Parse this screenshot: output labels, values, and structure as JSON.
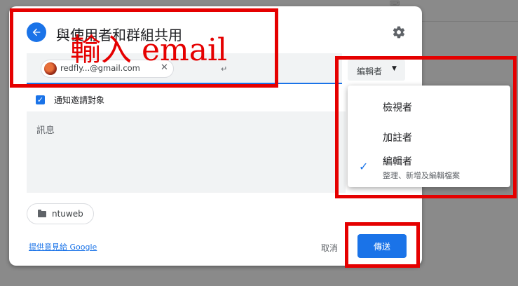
{
  "dialog": {
    "title": "與使用者和群組共用",
    "back_icon": "arrow-left-icon",
    "settings_icon": "gear-icon"
  },
  "recipient": {
    "email": "redfly...@gmail.com",
    "enter_mark": "↵"
  },
  "role_button": {
    "label": "編輯者",
    "caret": "▼"
  },
  "notify": {
    "checked": true,
    "label": "通知邀請對象"
  },
  "message": {
    "placeholder": "訊息"
  },
  "folder": {
    "name": "ntuweb"
  },
  "footer": {
    "feedback_link": "提供意見給 Google",
    "cancel": "取消",
    "send": "傳送"
  },
  "role_menu": {
    "items": [
      {
        "label": "檢視者",
        "checked": false
      },
      {
        "label": "加註者",
        "checked": false
      },
      {
        "label": "編輯者",
        "description": "整理、新增及編輯檔案",
        "checked": true
      }
    ],
    "check_glyph": "✓"
  },
  "annotation": {
    "text": "輸入 email",
    "color": "#e50000"
  },
  "colors": {
    "accent": "#1a73e8",
    "annotation": "#e50000",
    "overlay": "#8a8a8a"
  }
}
